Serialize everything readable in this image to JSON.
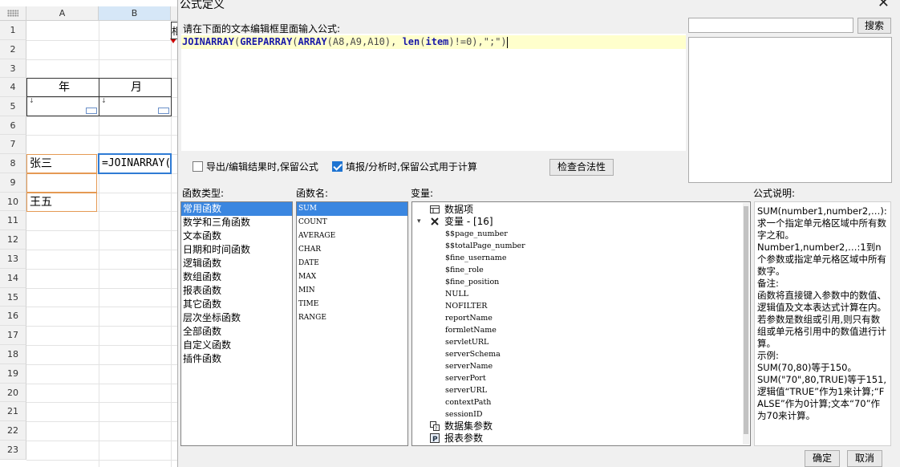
{
  "sheet": {
    "columns": [
      "A",
      "B"
    ],
    "rows": [
      "1",
      "2",
      "3",
      "4",
      "5",
      "6",
      "7",
      "8",
      "9",
      "10",
      "11",
      "12",
      "13",
      "14",
      "15",
      "16",
      "17",
      "18",
      "19",
      "20",
      "21",
      "22",
      "23"
    ],
    "header_year": "年",
    "header_month": "月",
    "cell_a8": "张三",
    "cell_b8": "=JOINARRAY(",
    "cell_a10": "王五",
    "cut_char": "相"
  },
  "dialog": {
    "title": "公式定义",
    "close_symbol": "✕",
    "prompt": "请在下面的文本编辑框里面输入公式:",
    "formula": "JOINARRAY(GREPARRAY(ARRAY(A8,A9,A10), len(item)!=0),\";\")",
    "search_placeholder": "",
    "search_button": "搜索",
    "option_keep_formula_export": "导出/编辑结果时,保留公式",
    "option_keep_formula_fill": "填报/分析时,保留公式用于计算",
    "option_keep_formula_export_checked": false,
    "option_keep_formula_fill_checked": true,
    "check_validity_button": "检查合法性",
    "category_label": "函数类型:",
    "categories": [
      "常用函数",
      "数学和三角函数",
      "文本函数",
      "日期和时间函数",
      "逻辑函数",
      "数组函数",
      "报表函数",
      "其它函数",
      "层次坐标函数",
      "全部函数",
      "自定义函数",
      "插件函数"
    ],
    "function_label": "函数名:",
    "functions": [
      "SUM",
      "COUNT",
      "AVERAGE",
      "CHAR",
      "DATE",
      "MAX",
      "MIN",
      "TIME",
      "RANGE"
    ],
    "variable_label": "变量:",
    "variables": {
      "data_item": "数据项",
      "var_group": "变量 - [16]",
      "leaves": [
        "$$page_number",
        "$$totalPage_number",
        "$fine_username",
        "$fine_role",
        "$fine_position",
        "NULL",
        "NOFILTER",
        "reportName",
        "formletName",
        "servletURL",
        "serverSchema",
        "serverName",
        "serverPort",
        "serverURL",
        "contextPath",
        "sessionID"
      ],
      "dataset_params": "数据集参数",
      "report_params": "报表参数"
    },
    "description_label": "公式说明:",
    "description": [
      {
        "text": "SUM(number1,number2,…):求一个指定单元格区域中所有数字之和。",
        "serif": false
      },
      {
        "text": "Number1,number2,…:1到n个参数或指定单元格区域中所有数字。",
        "serif": false
      },
      {
        "text": "备注:",
        "serif": false
      },
      {
        "text": "函数将直接键入参数中的数值、逻辑值及文本表达式计算在内。若参数是数组或引用,则只有数组或单元格引用中的数值进行计算。",
        "serif": false
      },
      {
        "text": "示例:",
        "serif": false
      },
      {
        "text": "SUM(70,80)等于150。",
        "serif": false
      },
      {
        "text": "SUM(\"70\",80,TRUE)等于151,逻辑值“TRUE”作为1来计算;“FALSE”作为0计算;文本“70”作为70来计算。",
        "serif": false
      }
    ],
    "ok_button": "确定",
    "cancel_button": "取消"
  },
  "colors": {
    "formula_text": "#1a1aa8",
    "selection": "#3a86e0",
    "editor_line": "#ffffcc"
  }
}
